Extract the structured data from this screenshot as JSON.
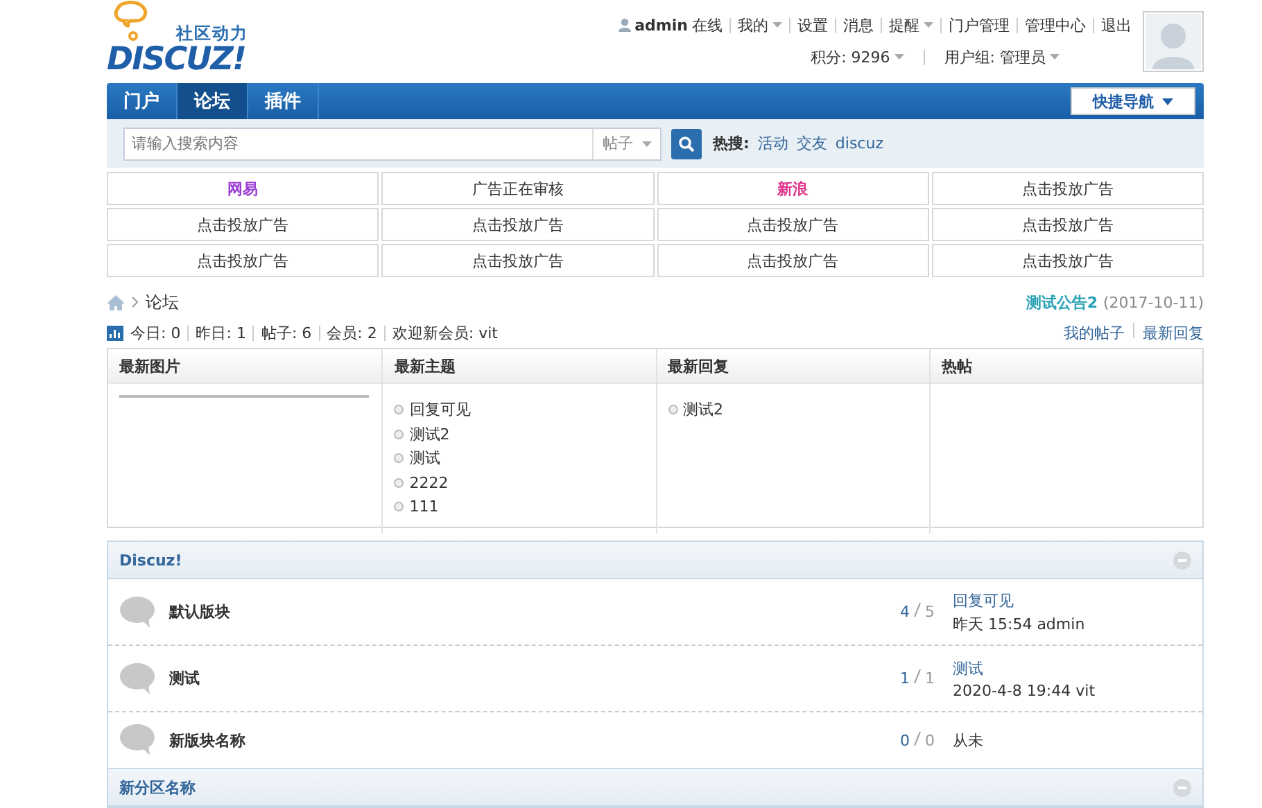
{
  "logo": {
    "tagline": "社区动力",
    "name": "DISCUZ!"
  },
  "user_bar": {
    "user": "admin",
    "status": "在线",
    "links": [
      {
        "label": "我的",
        "dropdown": true
      },
      {
        "label": "设置",
        "dropdown": false
      },
      {
        "label": "消息",
        "dropdown": false
      },
      {
        "label": "提醒",
        "dropdown": true
      },
      {
        "label": "门户管理",
        "dropdown": false
      },
      {
        "label": "管理中心",
        "dropdown": false
      },
      {
        "label": "退出",
        "dropdown": false
      }
    ],
    "info": [
      {
        "label": "积分: 9296",
        "dropdown": true
      },
      {
        "label": "用户组: 管理员",
        "dropdown": true
      }
    ]
  },
  "nav": {
    "tabs": [
      {
        "label": "门户",
        "selected": false
      },
      {
        "label": "论坛",
        "selected": true
      },
      {
        "label": "插件",
        "selected": false
      }
    ],
    "quick_nav": "快捷导航"
  },
  "search": {
    "placeholder": "请输入搜索内容",
    "type": "帖子",
    "hot_label": "热搜:",
    "hot": [
      "活动",
      "交友",
      "discuz"
    ]
  },
  "ads": [
    {
      "text": "网易",
      "color": "#9b3fd4"
    },
    {
      "text": "广告正在审核",
      "color": "#333333"
    },
    {
      "text": "新浪",
      "color": "#e0338a"
    },
    {
      "text": "点击投放广告",
      "color": "#333333"
    },
    {
      "text": "点击投放广告",
      "color": "#333333"
    },
    {
      "text": "点击投放广告",
      "color": "#333333"
    },
    {
      "text": "点击投放广告",
      "color": "#333333"
    },
    {
      "text": "点击投放广告",
      "color": "#333333"
    },
    {
      "text": "点击投放广告",
      "color": "#333333"
    },
    {
      "text": "点击投放广告",
      "color": "#333333"
    },
    {
      "text": "点击投放广告",
      "color": "#333333"
    },
    {
      "text": "点击投放广告",
      "color": "#333333"
    }
  ],
  "breadcrumb": [
    "论坛"
  ],
  "announcement": {
    "title": "测试公告2",
    "date": "(2017-10-11)"
  },
  "stats": [
    {
      "label": "今日:",
      "value": "0"
    },
    {
      "label": "昨日:",
      "value": "1"
    },
    {
      "label": "帖子:",
      "value": "6"
    },
    {
      "label": "会员:",
      "value": "2"
    },
    {
      "label": "欢迎新会员:",
      "value": "vit"
    }
  ],
  "quick_links": [
    "我的帖子",
    "最新回复"
  ],
  "portal_columns": [
    {
      "title": "最新图片",
      "kind": "images"
    },
    {
      "title": "最新主题",
      "kind": "list",
      "items": [
        "回复可见",
        "测试2",
        "测试",
        "2222",
        "111"
      ]
    },
    {
      "title": "最新回复",
      "kind": "list",
      "items": [
        "测试2"
      ]
    },
    {
      "title": "热帖",
      "kind": "list"
    }
  ],
  "forum_groups": [
    {
      "title": "Discuz!",
      "expanded": true,
      "forums": [
        {
          "name": "默认版块",
          "threads": "4",
          "posts": "5",
          "last_title": "回复可见",
          "last_info": "昨天 15:54 admin"
        },
        {
          "name": "测试",
          "threads": "1",
          "posts": "1",
          "last_title": "测试",
          "last_info": "2020-4-8 19:44 vit"
        },
        {
          "name": "新版块名称",
          "threads": "0",
          "posts": "0",
          "last_never": "从未"
        }
      ]
    },
    {
      "title": "新分区名称",
      "expanded": true
    }
  ]
}
